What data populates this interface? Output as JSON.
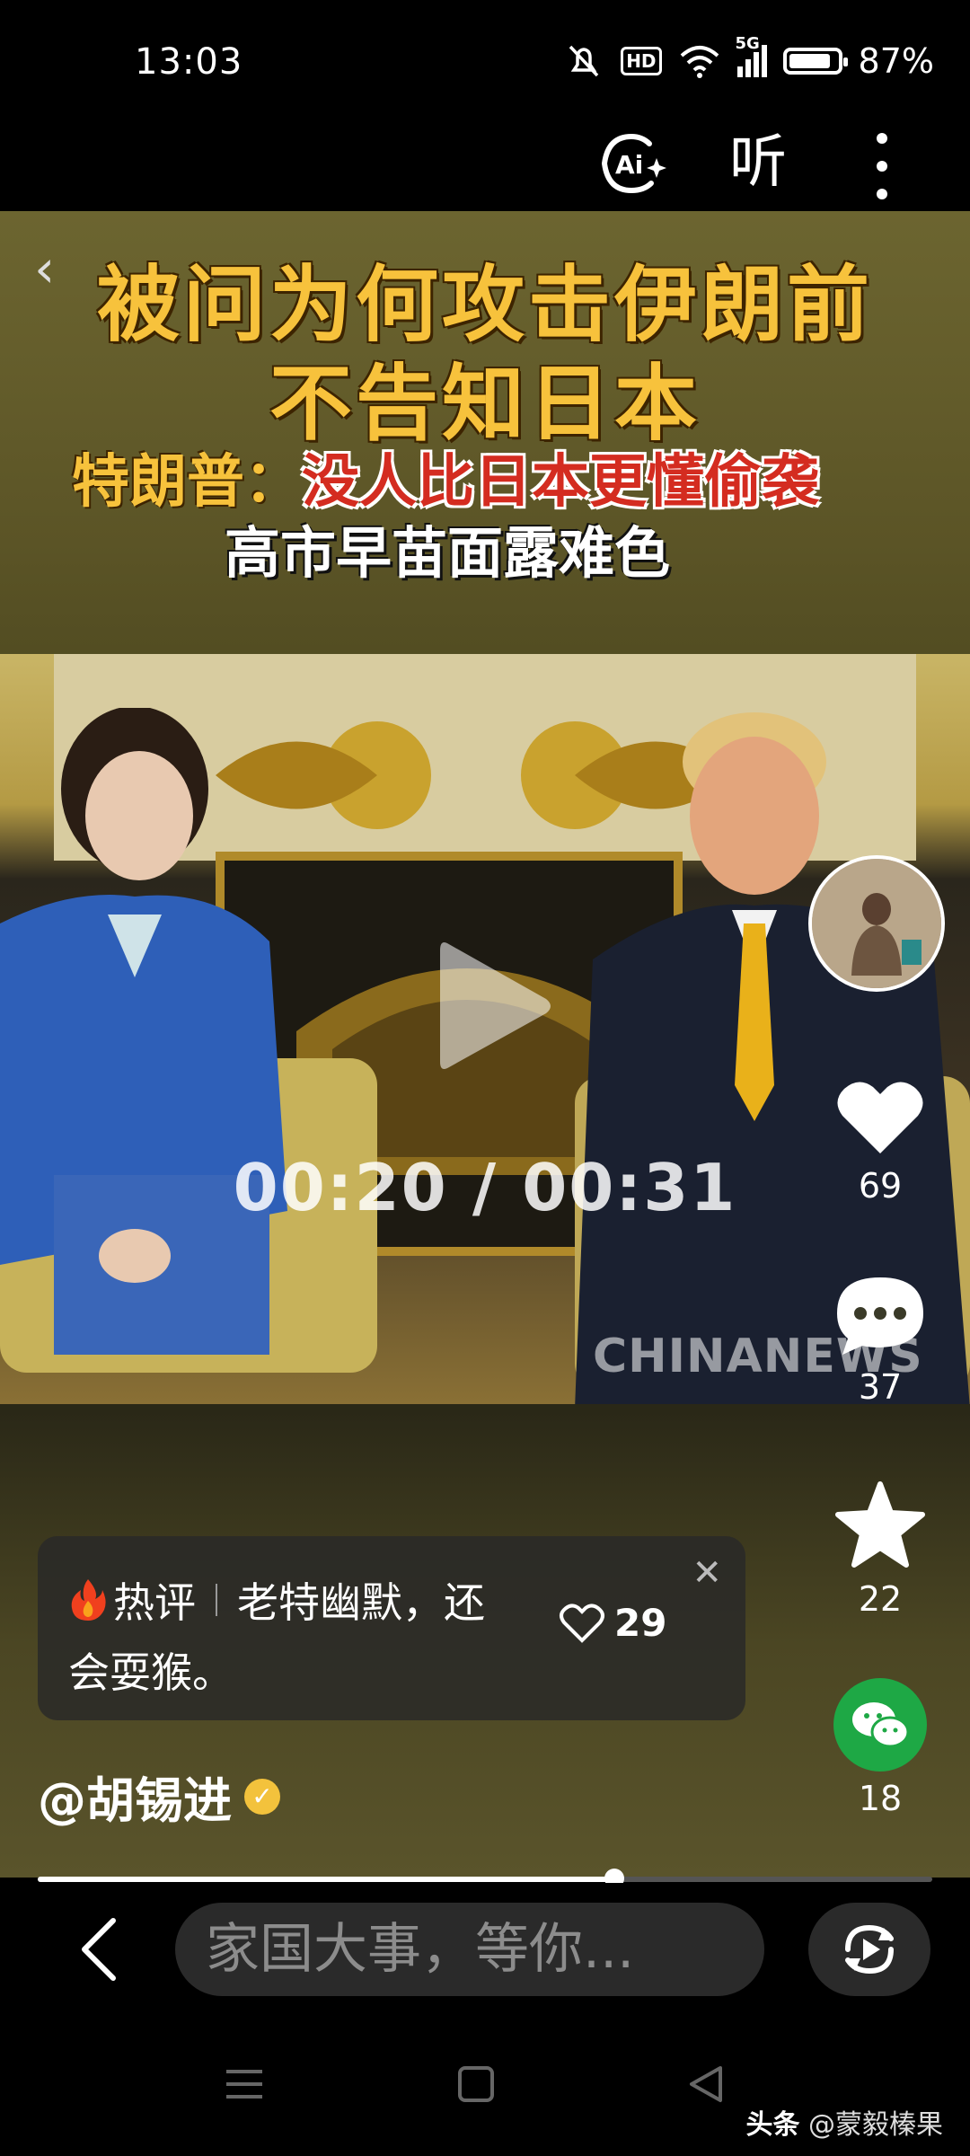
{
  "status_bar": {
    "time": "13:03",
    "network": "5G",
    "hd_label": "HD",
    "battery": "87%",
    "battery_level": 0.87
  },
  "toolbar": {
    "ai_icon": "ai-sparkle-icon",
    "listen_label": "听",
    "more_icon": "more-vertical-icon"
  },
  "video": {
    "headline_line1": "被问为何攻击伊朗前",
    "headline_line2": "不告知日本",
    "headline_line3_prefix": "特朗普：",
    "headline_line3_quote": "没人比日本更懂偷袭",
    "headline_line4": "高市早苗面露难色",
    "time_display": "00:20 / 00:31",
    "watermark": "CHINANEWS",
    "progress": 0.645
  },
  "actions": {
    "like_count": "69",
    "comment_count": "37",
    "favorite_count": "22",
    "share_count": "18"
  },
  "hot_comment": {
    "label": "热评",
    "text_line1": "老特幽默，还",
    "text_line2": "会耍猴。",
    "like_count": "29"
  },
  "author": {
    "name": "@胡锡进",
    "verified_mark": "✓"
  },
  "comment_input": {
    "placeholder": "家国大事，等你..."
  },
  "brand": {
    "prefix": "头条",
    "handle": " @蒙毅榛果"
  },
  "colors": {
    "headline_gold": "#f7c23c",
    "headline_red": "#d42c20",
    "wechat_green": "#1ea845",
    "verify_gold": "#f3c23c"
  }
}
